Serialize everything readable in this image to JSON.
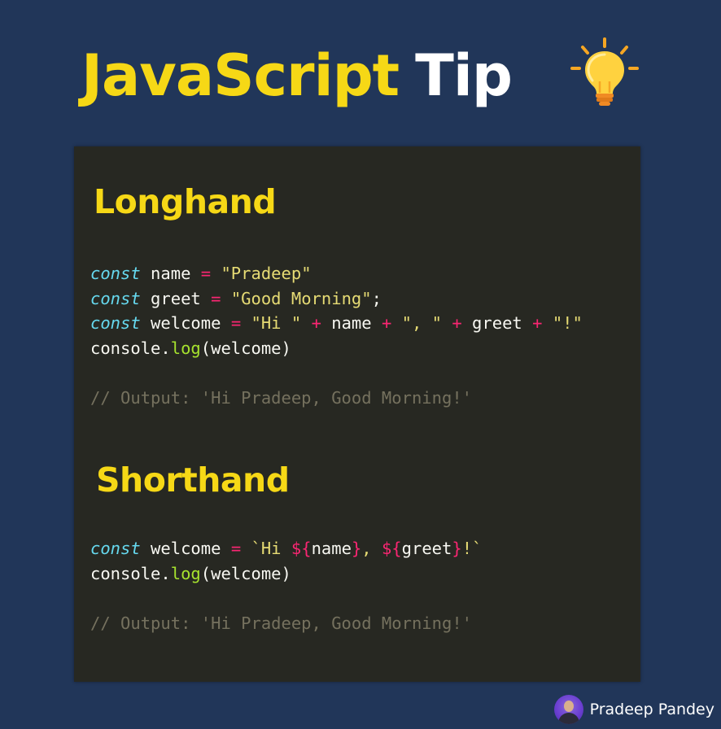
{
  "header": {
    "title_part1": "JavaScript",
    "title_part2": "Tip",
    "icon": "lightbulb-icon"
  },
  "longhand": {
    "heading": "Longhand",
    "lines": [
      [
        {
          "t": "const",
          "c": "kw"
        },
        {
          "t": " name ",
          "c": "plain"
        },
        {
          "t": "=",
          "c": "op"
        },
        {
          "t": " ",
          "c": "plain"
        },
        {
          "t": "\"Pradeep\"",
          "c": "str"
        }
      ],
      [
        {
          "t": "const",
          "c": "kw"
        },
        {
          "t": " greet ",
          "c": "plain"
        },
        {
          "t": "=",
          "c": "op"
        },
        {
          "t": " ",
          "c": "plain"
        },
        {
          "t": "\"Good Morning\"",
          "c": "str"
        },
        {
          "t": ";",
          "c": "plain"
        }
      ],
      [
        {
          "t": "const",
          "c": "kw"
        },
        {
          "t": " welcome ",
          "c": "plain"
        },
        {
          "t": "=",
          "c": "op"
        },
        {
          "t": " ",
          "c": "plain"
        },
        {
          "t": "\"Hi \"",
          "c": "str"
        },
        {
          "t": " ",
          "c": "plain"
        },
        {
          "t": "+",
          "c": "op"
        },
        {
          "t": " name ",
          "c": "plain"
        },
        {
          "t": "+",
          "c": "op"
        },
        {
          "t": " ",
          "c": "plain"
        },
        {
          "t": "\", \"",
          "c": "str"
        },
        {
          "t": " ",
          "c": "plain"
        },
        {
          "t": "+",
          "c": "op"
        },
        {
          "t": " greet ",
          "c": "plain"
        },
        {
          "t": "+",
          "c": "op"
        },
        {
          "t": " ",
          "c": "plain"
        },
        {
          "t": "\"!\"",
          "c": "str"
        }
      ],
      [
        {
          "t": "console.",
          "c": "plain"
        },
        {
          "t": "log",
          "c": "fn"
        },
        {
          "t": "(welcome)",
          "c": "plain"
        }
      ],
      [],
      [
        {
          "t": "// Output: 'Hi Pradeep, Good Morning!'",
          "c": "cm"
        }
      ]
    ]
  },
  "shorthand": {
    "heading": "Shorthand",
    "lines": [
      [
        {
          "t": "const",
          "c": "kw"
        },
        {
          "t": " welcome ",
          "c": "plain"
        },
        {
          "t": "=",
          "c": "op"
        },
        {
          "t": " ",
          "c": "plain"
        },
        {
          "t": "`Hi ",
          "c": "str"
        },
        {
          "t": "${",
          "c": "op"
        },
        {
          "t": "name",
          "c": "plain"
        },
        {
          "t": "}",
          "c": "op"
        },
        {
          "t": ", ",
          "c": "str"
        },
        {
          "t": "${",
          "c": "op"
        },
        {
          "t": "greet",
          "c": "plain"
        },
        {
          "t": "}",
          "c": "op"
        },
        {
          "t": "!`",
          "c": "str"
        }
      ],
      [
        {
          "t": "console.",
          "c": "plain"
        },
        {
          "t": "log",
          "c": "fn"
        },
        {
          "t": "(welcome)",
          "c": "plain"
        }
      ],
      [],
      [
        {
          "t": "// Output: 'Hi Pradeep, Good Morning!'",
          "c": "cm"
        }
      ]
    ]
  },
  "author": {
    "name": "Pradeep Pandey",
    "avatar_icon": "avatar-icon"
  },
  "colors": {
    "background": "#213659",
    "card": "#272822",
    "accent_yellow": "#f6d816",
    "keyword": "#66d9ef",
    "operator": "#f92672",
    "string": "#e6db74",
    "function": "#a6e22e",
    "comment": "#75715e",
    "text": "#f8f8f2"
  }
}
